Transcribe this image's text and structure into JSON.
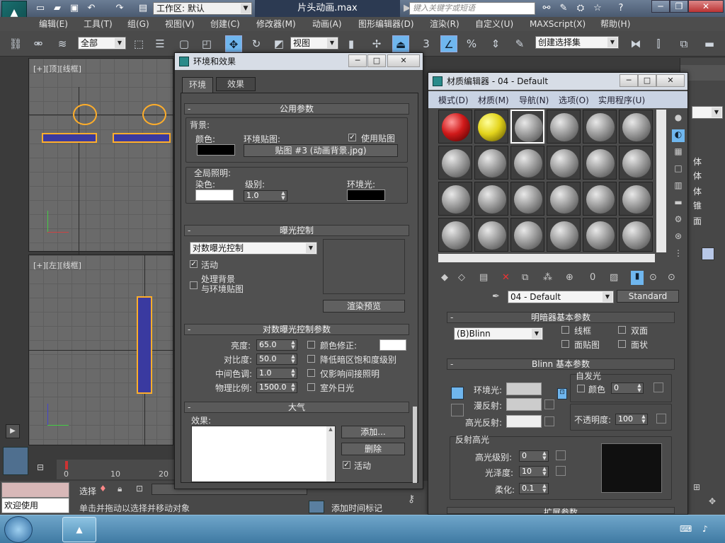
{
  "titlebar": {
    "workspace": "工作区: 默认",
    "file": "片头动画.max",
    "search_placeholder": "键入关键字或短语"
  },
  "menus": [
    "编辑(E)",
    "工具(T)",
    "组(G)",
    "视图(V)",
    "创建(C)",
    "修改器(M)",
    "动画(A)",
    "图形编辑器(D)",
    "渲染(R)",
    "自定义(U)",
    "MAXScript(X)",
    "帮助(H)"
  ],
  "toolbar": {
    "selection_filter": "全部",
    "ref_coord": "视图",
    "named_selection": "创建选择集"
  },
  "viewports": {
    "top_label": "[+][顶][线框]",
    "left_label": "[+][左][线框]"
  },
  "status": {
    "welcome": "欢迎使用 MAXSc",
    "select_label": "选择",
    "prompt": "单击并拖动以选择并移动对象",
    "add_time_tag": "添加时间标记",
    "ticks": [
      "0",
      "10",
      "20"
    ]
  },
  "env_dialog": {
    "title": "环境和效果",
    "tabs": [
      "环境",
      "效果"
    ],
    "common": {
      "header": "公用参数",
      "background": "背景:",
      "color_label": "颜色:",
      "env_map_label": "环境贴图:",
      "use_map": "使用贴图",
      "map_button": "贴图 #3 (动画背景.jpg)",
      "global_lighting": "全局照明:",
      "tint_label": "染色:",
      "level_label": "级别:",
      "level_value": "1.0",
      "ambient_label": "环境光:"
    },
    "exposure": {
      "header": "曝光控制",
      "selected": "对数曝光控制",
      "active": "活动",
      "process_bg": "处理背景",
      "process_bg2": "与环境贴图",
      "render_preview": "渲染预览"
    },
    "log_params": {
      "header": "对数曝光控制参数",
      "brightness_label": "亮度:",
      "brightness": "65.0",
      "contrast_label": "对比度:",
      "contrast": "50.0",
      "midtones_label": "中间色调:",
      "midtones": "1.0",
      "physical_label": "物理比例:",
      "physical": "1500.0",
      "color_correction": "颜色修正:",
      "desaturate": "降低暗区饱和度级别",
      "indirect_only": "仅影响间接照明",
      "exterior": "室外日光"
    },
    "atmosphere": {
      "header": "大气",
      "effects_label": "效果:",
      "add": "添加...",
      "delete": "删除",
      "active": "活动"
    }
  },
  "mat_editor": {
    "title": "材质编辑器 - 04 - Default",
    "menus": [
      "模式(D)",
      "材质(M)",
      "导航(N)",
      "选项(O)",
      "实用程序(U)"
    ],
    "material_name": "04 - Default",
    "material_type": "Standard",
    "shader_header": "明暗器基本参数",
    "shader": "(B)Blinn",
    "wire": "线框",
    "two_sided": "双面",
    "face_map": "面贴图",
    "faceted": "面状",
    "blinn_header": "Blinn 基本参数",
    "self_illum": "自发光",
    "color": "颜色",
    "self_illum_value": "0",
    "ambient": "环境光:",
    "diffuse": "漫反射:",
    "specular": "高光反射:",
    "opacity_label": "不透明度:",
    "opacity": "100",
    "spec_highlights": "反射高光",
    "spec_level_label": "高光级别:",
    "spec_level": "0",
    "glossiness_label": "光泽度:",
    "glossiness": "10",
    "soften_label": "柔化:",
    "soften": "0.1",
    "extended": "扩展参数"
  },
  "command_panel": {
    "items": [
      "体",
      "体",
      "体",
      "锥",
      "面"
    ]
  },
  "colors": {
    "accent": "#6fb6ee",
    "red_sphere": "#d11a1a",
    "yellow_sphere": "#e3d41c"
  }
}
